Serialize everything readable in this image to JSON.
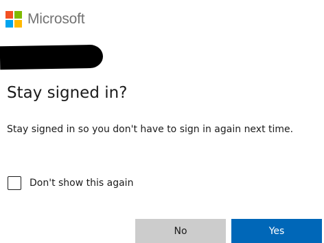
{
  "brand": {
    "name": "Microsoft",
    "logo_colors": [
      "#f25022",
      "#7fba00",
      "#00a4ef",
      "#ffb900"
    ]
  },
  "account": {
    "redacted": true
  },
  "dialog": {
    "title": "Stay signed in?",
    "description": "Stay signed in so you don't have to sign in again next time.",
    "checkbox": {
      "label": "Don't show this again",
      "checked": false
    },
    "buttons": {
      "no_label": "No",
      "yes_label": "Yes"
    }
  },
  "colors": {
    "primary": "#0067b8",
    "secondary_button": "#cccccc",
    "text": "#1b1b1b",
    "brand_text": "#737373"
  }
}
